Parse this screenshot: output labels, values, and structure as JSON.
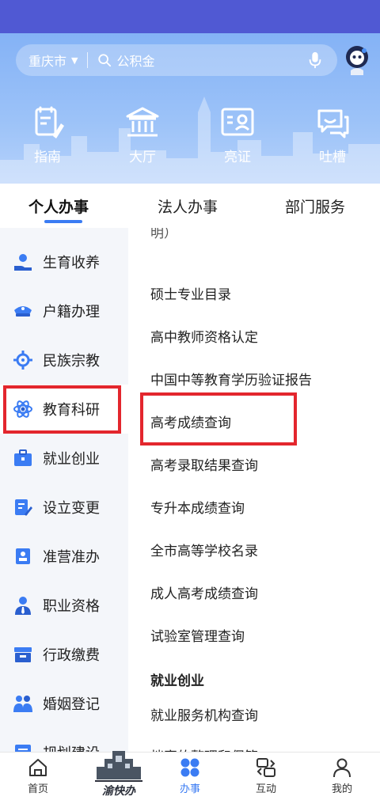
{
  "header": {
    "city": "重庆市",
    "search_placeholder": "公积金"
  },
  "quick_actions": [
    {
      "label": "指南",
      "icon": "guide-icon"
    },
    {
      "label": "大厅",
      "icon": "hall-icon"
    },
    {
      "label": "亮证",
      "icon": "license-icon"
    },
    {
      "label": "吐槽",
      "icon": "feedback-icon"
    }
  ],
  "tabs": [
    {
      "label": "个人办事",
      "active": true
    },
    {
      "label": "法人办事",
      "active": false
    },
    {
      "label": "部门服务",
      "active": false
    }
  ],
  "sidebar": {
    "items": [
      {
        "label": "生育收养",
        "icon": "baby-hand-icon"
      },
      {
        "label": "户籍办理",
        "icon": "police-cap-icon"
      },
      {
        "label": "民族宗教",
        "icon": "dharma-wheel-icon"
      },
      {
        "label": "教育科研",
        "icon": "atom-icon",
        "active": true
      },
      {
        "label": "就业创业",
        "icon": "briefcase-icon"
      },
      {
        "label": "设立变更",
        "icon": "edit-document-icon"
      },
      {
        "label": "准营准办",
        "icon": "stamp-icon"
      },
      {
        "label": "职业资格",
        "icon": "person-tie-icon"
      },
      {
        "label": "行政缴费",
        "icon": "tray-icon"
      },
      {
        "label": "婚姻登记",
        "icon": "couple-icon"
      },
      {
        "label": "规划建设",
        "icon": "planning-icon"
      }
    ]
  },
  "service_list": {
    "cut_top_text": "明）",
    "rows": [
      {
        "label": "硕士专业目录"
      },
      {
        "label": "高中教师资格认定"
      },
      {
        "label": "中国中等教育学历验证报告"
      },
      {
        "label": "高考成绩查询"
      },
      {
        "label": "高考录取结果查询"
      },
      {
        "label": "专升本成绩查询"
      },
      {
        "label": "全市高等学校名录"
      },
      {
        "label": "成人高考成绩查询"
      },
      {
        "label": "试验室管理查询"
      },
      {
        "label": "就业创业"
      },
      {
        "label": "就业服务机构查询"
      },
      {
        "label": "档案的整理和保管"
      }
    ]
  },
  "bottom_nav": {
    "items": [
      {
        "label": "首页",
        "icon": "home-icon"
      },
      {
        "label": "渝快办",
        "icon": "yukuaiban-logo"
      },
      {
        "label": "办事",
        "icon": "apps-icon",
        "active": true
      },
      {
        "label": "互动",
        "icon": "interact-icon"
      },
      {
        "label": "我的",
        "icon": "profile-icon"
      }
    ]
  },
  "colors": {
    "status_bar": "#5059d3",
    "hero_top": "#84b2f6",
    "accent": "#3b7cf3",
    "highlight_box": "#e3262d",
    "sidebar_bg": "#f4f6fa"
  }
}
